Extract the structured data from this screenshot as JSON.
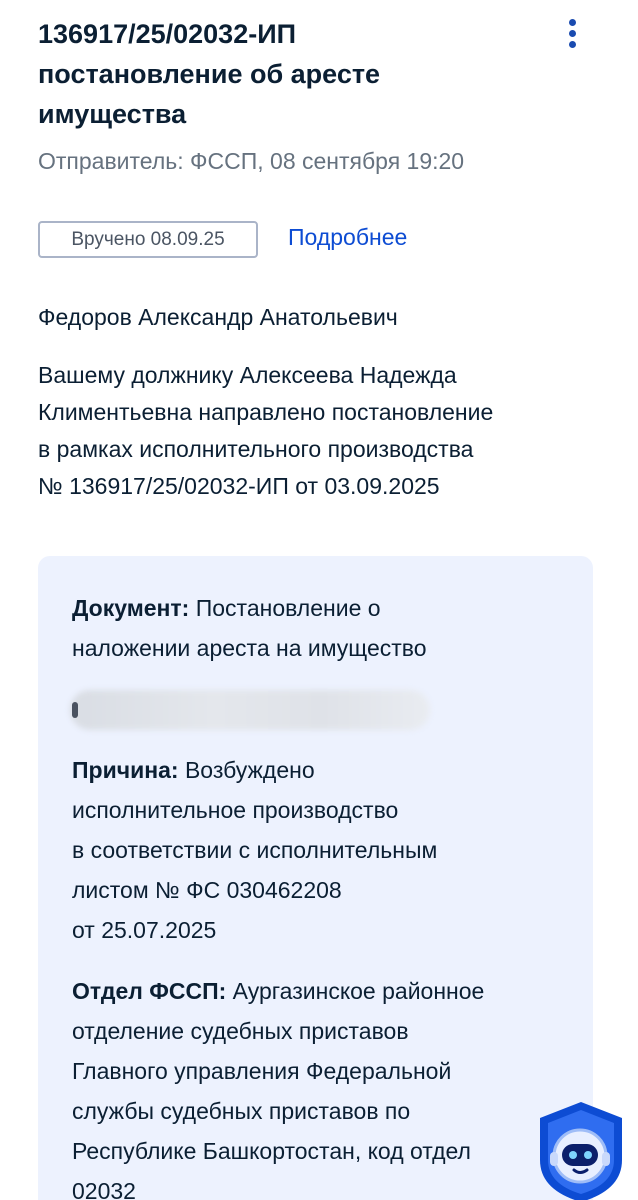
{
  "header": {
    "title_lines": [
      "136917/25/02032-ИП",
      "постановление об аресте",
      "имущества"
    ],
    "more_icon": "more-vertical-icon",
    "sender": "Отправитель: ФССП, 08 сентября 19:20"
  },
  "status": {
    "badge": "Вручено 08.09.25",
    "details_link": "Подробнее"
  },
  "recipient": "Федоров Александр Анатольевич",
  "message_lines": [
    "Вашему должнику Алексеева Надежда",
    "Климентьевна направлено постановление",
    "в рамках исполнительного производства",
    "№ 136917/25/02032-ИП от 03.09.2025"
  ],
  "card": {
    "document": {
      "label": "Документ:",
      "line1": " Постановление о",
      "line2": "наложении ареста на имущество"
    },
    "reason": {
      "label": "Причина:",
      "line1": " Возбуждено",
      "line2": "исполнительное производство",
      "line3": "в соответствии с исполнительным",
      "line4": "листом № ФС 030462208",
      "line5": "от 25.07.2025"
    },
    "department": {
      "label": "Отдел ФССП:",
      "line1": " Аургазинское районное",
      "line2": "отделение судебных приставов",
      "line3": "Главного управления Федеральной",
      "line4": "службы судебных приставов по",
      "line5": "Республике Башкортостан, код отдел",
      "line6": "02032"
    }
  },
  "assistant_icon": "robot-assistant-icon",
  "colors": {
    "text": "#0b1f33",
    "secondary_text": "#66727f",
    "link": "#0d4cd3",
    "card_background": "#edf2fe",
    "assistant_blue": "#0d4cd3"
  }
}
